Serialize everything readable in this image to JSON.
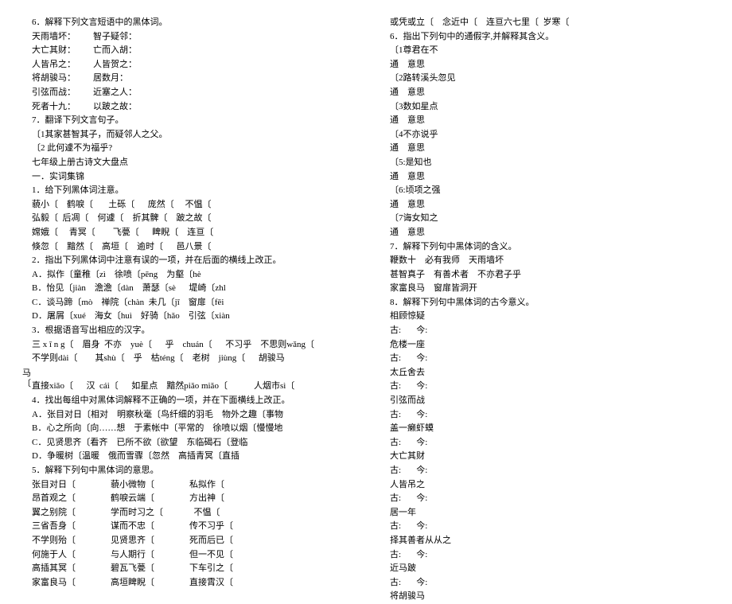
{
  "left_col": [
    "6．解释下列文言短语中的黑体词。",
    "天雨墙坏：        智子疑邻：",
    "大亡其财：        亡而入胡：",
    "人皆吊之：        人皆贺之：",
    "将胡骏马：        居数月：",
    "引弦而战：        近塞之人：",
    "死者十九：        以跛之故：",
    "7．翻译下列文言句子。",
    "〔1其家甚智其子，而疑邻人之父。",
    "〔2 此何遽不为福乎?",
    "七年级上册古诗文大盘点",
    "一．实词集锦",
    "1．给下列黑体词注意。",
    "藐小〔    鹤唳〔       土砾〔      庞然〔     不愠〔",
    "弘毅〔  后凋〔    何遽〔    折其髀〔    跛之故〔",
    "嫦娥〔     青冥〔        飞甍〔      睥睨〔    连亘〔",
    "倏忽〔    黯然〔    高垣〔    逾时〔      邑八景〔",
    "2．指出下列黑体词中注意有误的一项，并在后面的横线上改正。",
    "A．拟作〔童稚〔zì    徐喷〔pēng    为壑〔hè",
    "B．怡见〔jiàn    澹澹〔dàn    萧瑟〔sè      堤崎〔zhl",
    "C．谈马蹄〔mò    禅院〔chàn  未几〔jī    窗扉〔fēi",
    "D．屠屑〔xué    海女〔huì    好骑〔hǎo    引弦〔xiàn",
    "3．根据语音写出相应的汉字。",
    "三 x ī n g〔    眉身  不亦    yuè〔      乎    chuán〔      不习乎    不思则wǎng〔",
    "不学则dài〔        其shù〔    乎    枯téng〔    老树    jiùng〔      胡骏马",
    "                                                                              ",
    "直接xiǎo〔      汉  cái〔      如星点    黯然piǎo miǎo〔            人烟市sì〔",
    "",
    "4．找出每组中对黑体词解释不正确的一项，并在下面横线上改正。",
    "A．张目对日〔相对    明察秋毫〔鸟纤细的羽毛    物外之趣〔事物",
    "B．心之所向〔向……想    于素帐中〔平常的    徐喷以烟〔慢慢地",
    "C．见贤思齐〔看齐    已所不欲〔欲望    东临碣石〔登临",
    "D．争暖树〔温暖    俄而雪骤〔忽然    高插青冥〔直插",
    "5．解释下列句中黑体词的意思。",
    "张目对日〔                藐小微物〔                私拟作〔",
    "昂首观之〔                鹤唳云端〔                方出神〔",
    "翼之别院〔                学而时习之〔              不愠〔",
    "三省吾身〔                谋而不忠〔                传不习乎〔",
    "不学则殆〔                见贤思齐〔                死而后已〔",
    "何施于人〔                与人期行〔                但一不见〔",
    "高插其冥〔                碧瓦飞甍〔                下车引之〔",
    "家富良马〔                高垣睥睨〔                直接霄汉〔"
  ],
  "right_col": [
    "或凭或立〔    念近中〔    连亘六七里〔  岁寒〔",
    "6．指出下列句中的通假字,并解释其含义。",
    "〔1尊君在不",
    "通    意思",
    "〔2路转溪头忽见",
    "通    意思",
    "〔3数如星点",
    "通    意思",
    "〔4不亦说乎",
    "通    意思",
    "〔5:是知也",
    "通    意思",
    "〔6:顷项之强",
    "通    意思",
    "〔7诲女知之",
    "通    意思",
    "7．解释下列句中黑体词的含义。",
    "鞭数十    必有我师    天雨墙坏",
    "甚智真子    有善术者    不亦君子乎",
    "家富良马    窗扉皆洞开",
    "8．解释下列句中黑体词的古今意义。",
    "相顾惊疑",
    "古:       今:",
    "危楼一座",
    "古:       今:",
    "太丘舍去",
    "古:       今:",
    "引弦而战",
    "古:       今:",
    "盖一癞虾蟆",
    "古:       今:",
    "大亡其财",
    "古:       今:",
    "人皆吊之",
    "古:       今:",
    "居一年",
    "古:       今:",
    "择其善者从从之",
    "古:       今:",
    "近马跛",
    "古:       今:",
    "将胡骏马"
  ],
  "left_margin": "马\n〔"
}
